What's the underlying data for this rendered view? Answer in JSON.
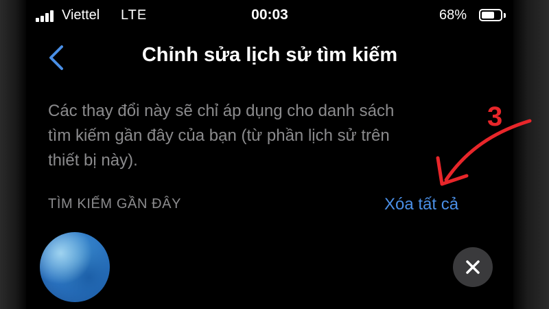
{
  "status_bar": {
    "carrier": "Viettel",
    "network": "LTE",
    "time": "00:03",
    "battery_percent": "68%",
    "battery_level": 0.68,
    "signal_bars": 4
  },
  "header": {
    "back_icon": "chevron-left-icon",
    "title": "Chỉnh sửa lịch sử tìm kiếm"
  },
  "description": {
    "lines": [
      "Các thay đổi này sẽ chỉ áp dụng cho danh sách",
      "tìm kiếm gần đây của bạn (từ phần lịch sử trên",
      "thiết bị này)."
    ]
  },
  "recent_searches": {
    "section_title": "TÌM KIẾM GẦN ĐÂY",
    "clear_all_label": "Xóa tất cả",
    "items": [
      {
        "avatar_icon": "avatar",
        "remove_icon": "close-icon"
      }
    ]
  },
  "annotation": {
    "step_number": "3",
    "color": "#e8262a"
  },
  "colors": {
    "background": "#000000",
    "accent": "#4a8fe6",
    "secondary_text": "#8b8b8d",
    "remove_button_bg": "#3a3a3c"
  }
}
